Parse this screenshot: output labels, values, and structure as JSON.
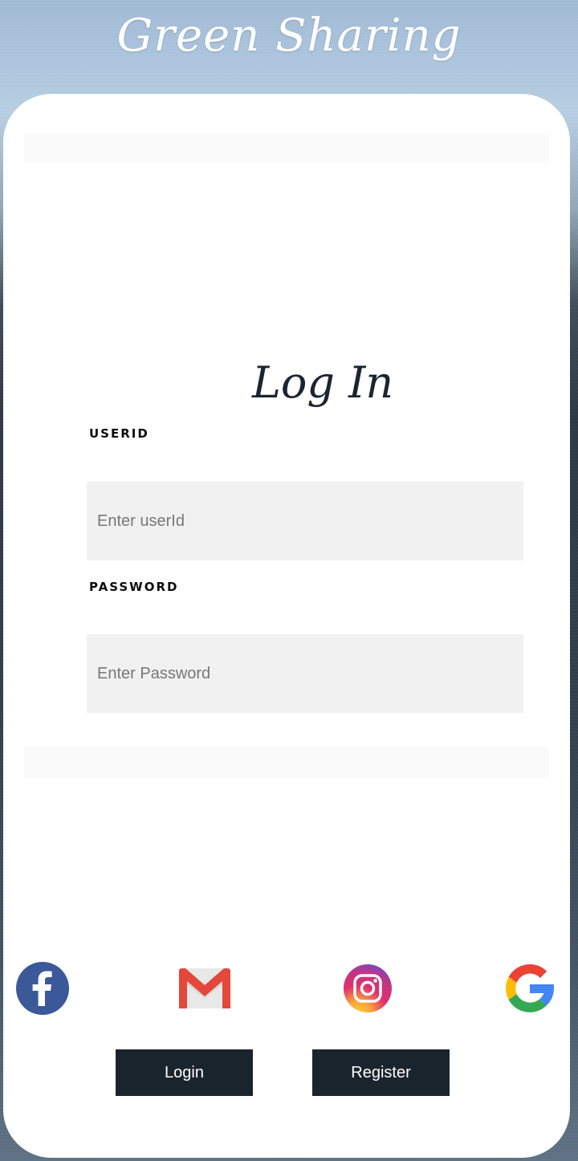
{
  "header": {
    "title": "Green Sharing"
  },
  "form": {
    "heading": "Log In",
    "userid": {
      "label": "USERID",
      "placeholder": "Enter userId",
      "value": ""
    },
    "password": {
      "label": "PASSWORD",
      "placeholder": "Enter Password",
      "value": ""
    }
  },
  "social": [
    {
      "name": "facebook",
      "icon": "facebook-icon",
      "color": "#3b5998"
    },
    {
      "name": "gmail",
      "icon": "gmail-icon",
      "color": "#ea4335"
    },
    {
      "name": "instagram",
      "icon": "instagram-icon",
      "color": "#c13584"
    },
    {
      "name": "google",
      "icon": "google-icon",
      "color": "#4285f4"
    }
  ],
  "buttons": {
    "login": "Login",
    "register": "Register"
  },
  "colors": {
    "card": "#ffffff",
    "input_bg": "#f1f1f1",
    "button_bg": "#1a242d"
  }
}
